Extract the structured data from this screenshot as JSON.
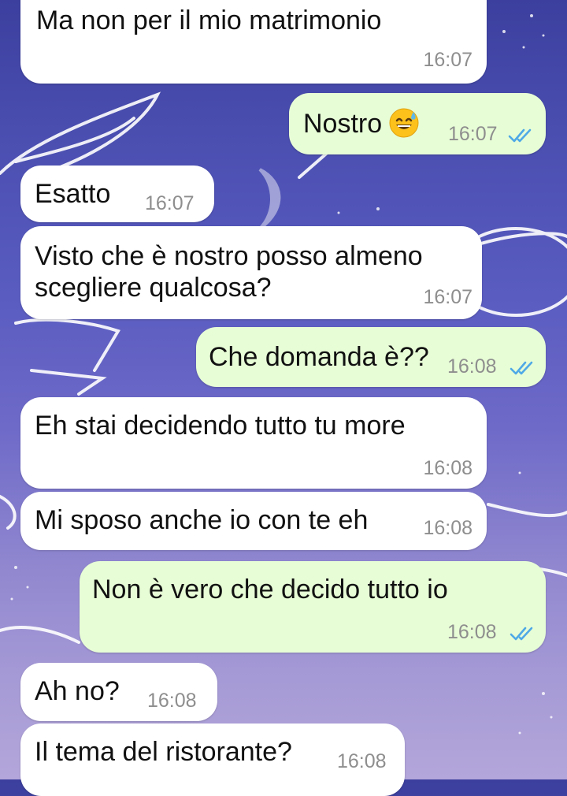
{
  "chat": {
    "messages": [
      {
        "dir": "in",
        "text": "Ma non per il mio matrimonio",
        "time": "16:07"
      },
      {
        "dir": "out",
        "text": "Nostro",
        "emoji": "sweat-smile",
        "time": "16:07",
        "status": "read"
      },
      {
        "dir": "in",
        "text": "Esatto",
        "time": "16:07"
      },
      {
        "dir": "in",
        "text_line1": "Visto che è nostro posso almeno",
        "text_line2": "scegliere qualcosa?",
        "time": "16:07"
      },
      {
        "dir": "out",
        "text": "Che domanda è??",
        "time": "16:08",
        "status": "read"
      },
      {
        "dir": "in",
        "text": "Eh stai decidendo tutto tu more",
        "time": "16:08"
      },
      {
        "dir": "in",
        "text": "Mi sposo anche io con te eh",
        "time": "16:08"
      },
      {
        "dir": "out",
        "text": "Non è vero che decido tutto io",
        "time": "16:08",
        "status": "read"
      },
      {
        "dir": "in",
        "text": "Ah no?",
        "time": "16:08"
      },
      {
        "dir": "in",
        "text": "Il tema del ristorante?",
        "time": "16:08"
      }
    ]
  },
  "colors": {
    "incoming_bubble": "#ffffff",
    "outgoing_bubble": "#e7fdd6",
    "read_ticks": "#4fa9e6",
    "timestamp": "#8e8e8e"
  }
}
